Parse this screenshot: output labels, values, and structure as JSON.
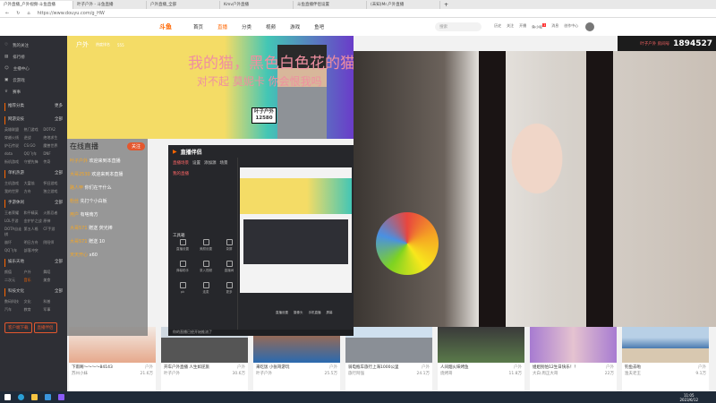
{
  "browser": {
    "tabs": [
      "户外直播_户外视频-斗鱼直播",
      "叶子户外 - 斗鱼直播",
      "户外直播_全部",
      "Kmv户外直播",
      "斗鱼直播伴侣设置",
      "(未知)Mr.户外直播"
    ],
    "url": "https://www.douyu.com/g_HW"
  },
  "header": {
    "logo": "斗鱼",
    "nav": [
      "首页",
      "直播",
      "分类",
      "视频",
      "游戏",
      "鱼吧"
    ],
    "search_placeholder": "搜索",
    "icons": [
      "历史",
      "关注",
      "开播",
      "鱼小秘",
      "消息",
      "创作中心"
    ],
    "notification_count": "1"
  },
  "sidebar": {
    "items": [
      "我的关注",
      "排行榜",
      "主播中心",
      "云游戏",
      "赛事"
    ],
    "sections": [
      {
        "title": "推荐分类",
        "more": "更多"
      },
      {
        "title": "网游竞技",
        "more": "全部",
        "items": [
          "英雄联盟",
          "热门游戏",
          "DOTA2",
          "穿越火线",
          "逆战",
          "绝地求生",
          "炉石传说",
          "CS:GO",
          "魔兽世界",
          "dota",
          "QQ飞车",
          "DNF",
          "街机游戏",
          "守望先锋",
          "传奇"
        ]
      },
      {
        "title": "单机热游",
        "more": "全部",
        "items": [
          "主机游戏",
          "大富翁",
          "怀旧游戏",
          "我的世界",
          "方舟",
          "独立游戏"
        ]
      },
      {
        "title": "手游休闲",
        "more": "全部",
        "items": [
          "王者荣耀",
          "和平精英",
          "火影忍者",
          "LOL手游",
          "金铲铲之战",
          "原神",
          "DOTA自走棋",
          "第五人格",
          "CF手游",
          "崩坏",
          "明日方舟",
          "阴阳师",
          "QQ飞车",
          "部落冲突"
        ]
      },
      {
        "title": "娱乐天地",
        "more": "全部",
        "items": [
          "颜值",
          "户外",
          "舞蹈",
          "二次元",
          "音乐",
          "美食"
        ]
      },
      {
        "title": "科技文化",
        "more": "全部",
        "items": [
          "数码科技",
          "文化",
          "科普",
          "汽车",
          "教育",
          "军事"
        ]
      }
    ],
    "buttons": [
      "客户端下载",
      "直播伴侣"
    ]
  },
  "banner": {
    "category": "户外",
    "stat1": "热度排名",
    "stat2": "555",
    "text1": "我的猫，黑色白色花的猫",
    "text2": "对不起 莫妮卡 你会恨我吗",
    "badge_line1": "叶子户外",
    "badge_line2": "12580"
  },
  "room": {
    "label": "叶子户外 房间号",
    "number": "1894527"
  },
  "chat": {
    "title": "在线直播",
    "button": "关注",
    "messages": [
      {
        "user": "叶子户外",
        "text": "欢迎来到本直播"
      },
      {
        "user": "大哥2530",
        "text": "欢迎来到本直播"
      },
      {
        "user": "路人甲",
        "text": "你们在干什么"
      },
      {
        "user": "粉丝",
        "text": "先打个小白板"
      },
      {
        "user": "用户",
        "text": "有啥南方"
      },
      {
        "user": "大哥571",
        "text": "赠送 荧光棒"
      },
      {
        "user": "大哥571",
        "text": "赠送 10"
      },
      {
        "user": "天天开心",
        "text": "x60"
      }
    ]
  },
  "obs": {
    "title": "直播伴侣",
    "tabs": [
      "直播场景",
      "设置",
      "添加源",
      "场景"
    ],
    "scene_title": "我的直播",
    "tools_label": "工具箱",
    "tools": [
      "直播设置",
      "美颜设置",
      "录屏",
      "弹幕助手",
      "录入视频",
      "直播间",
      "pk",
      "连麦",
      "更多"
    ],
    "footer": "你的直播已经开始推流了",
    "bottom_buttons": [
      "直播设置",
      "摄像头",
      "手机直播",
      "屏幕"
    ]
  },
  "cards": [
    {
      "title": "下雨啊～～～～84143",
      "anchor": "苏州小妹",
      "hot": "21.6万",
      "tag": "户外"
    },
    {
      "title": "开车户外直播 人生如逆旅",
      "anchor": "叶子户外",
      "hot": "30.6万",
      "tag": "户外"
    },
    {
      "title": "来吃饭 小张哥游玩",
      "anchor": "叶子户外",
      "hot": "25.5万",
      "tag": "户外"
    },
    {
      "title": "骑电瓶车旅行上海1000公里",
      "anchor": "旅行阿强",
      "hot": "24.1万",
      "tag": "户外"
    },
    {
      "title": "人间烟火味烤鱼",
      "anchor": "烧烤哥",
      "hot": "11.8万",
      "tag": "户外"
    },
    {
      "title": "姐姐别怕12生日快乐！！",
      "anchor": "大白·周正大哥",
      "hot": "22万",
      "tag": "户外"
    },
    {
      "title": "钓鱼去啦",
      "anchor": "渔夫老王",
      "hot": "9.1万",
      "tag": "户外"
    }
  ],
  "taskbar": {
    "time": "11:05",
    "date": "2023/6/12"
  }
}
